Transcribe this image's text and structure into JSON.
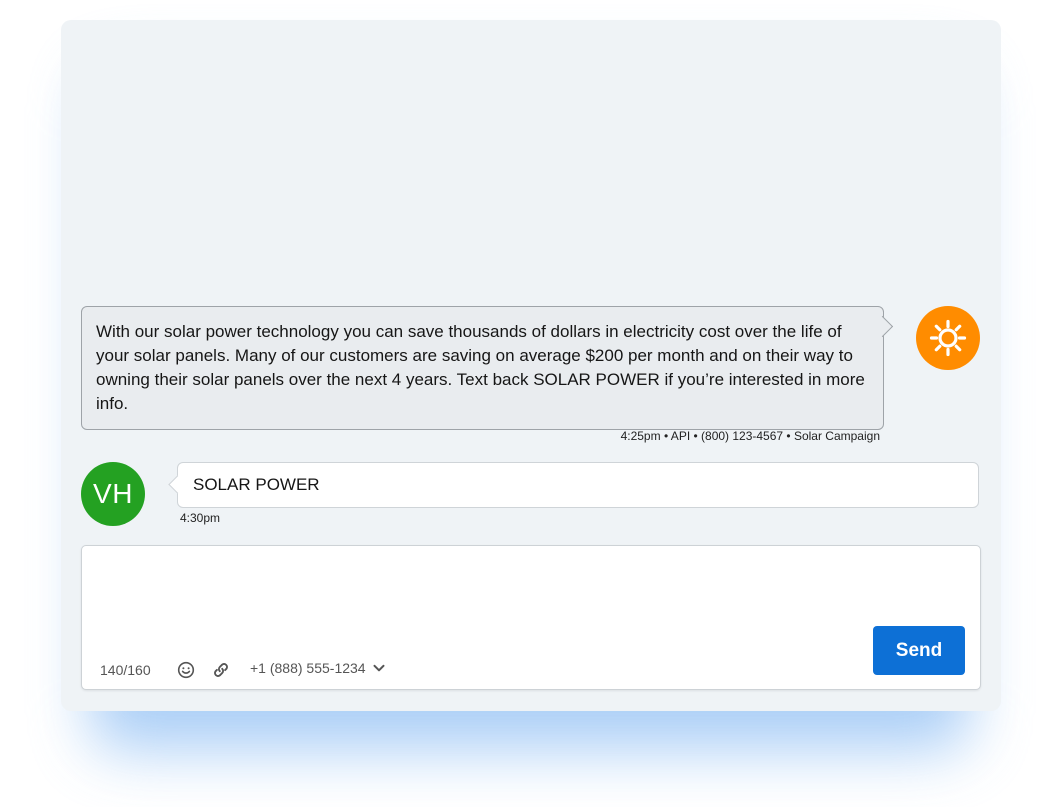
{
  "conversation": {
    "outgoing": {
      "text": "With our solar power technology you can save thousands of dollars in electricity cost over the life of your solar panels. Many of our customers are saving on average $200 per month and on their way to owning their solar panels over the next 4 years. Text back SOLAR POWER if you’re interested in more info.",
      "meta": "4:25pm • API • (800) 123-4567 • Solar Campaign",
      "avatar_icon": "sun-icon",
      "avatar_color": "#ff8c00"
    },
    "incoming": {
      "text": "SOLAR POWER",
      "time": "4:30pm",
      "avatar_initials": "VH",
      "avatar_color": "#24a122"
    }
  },
  "composer": {
    "value": "",
    "char_count": "140/160",
    "emoji_icon": "emoji-icon",
    "link_icon": "link-icon",
    "from_number": "+1 (888) 555-1234",
    "send_label": "Send",
    "send_color": "#0d70d6"
  }
}
